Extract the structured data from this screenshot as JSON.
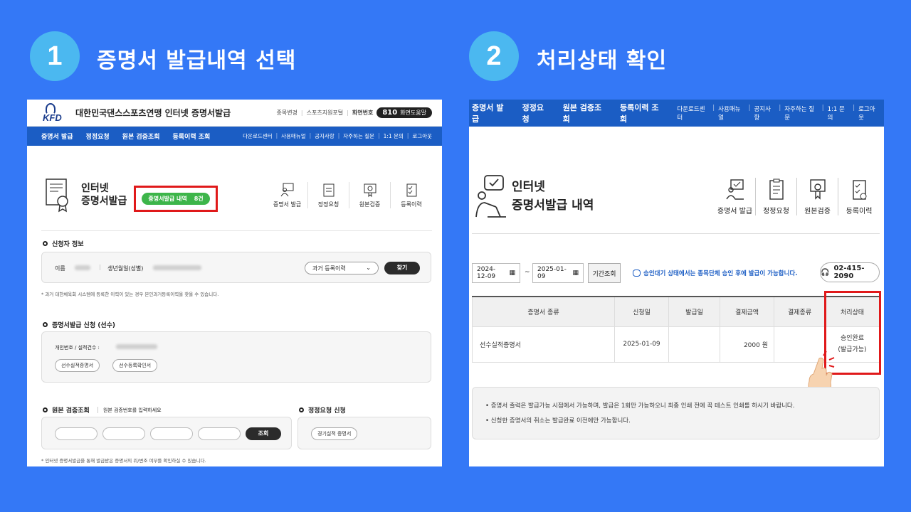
{
  "steps": [
    {
      "number": "1",
      "title": "증명서 발급내역 선택"
    },
    {
      "number": "2",
      "title": "처리상태 확인"
    }
  ],
  "left": {
    "logo_text": "KFD",
    "org_title": "대한민국댄스스포츠연맹 인터넷 증명서발급",
    "top_links": [
      "종목변경",
      "스포츠지원포털",
      "화면번호"
    ],
    "phone_code": "810",
    "phone_label": "화면도움말",
    "nav": [
      "증명서 발급",
      "정정요청",
      "원본 검증조회",
      "등록이력 조회"
    ],
    "nav_right": [
      "다운로드센터",
      "사용매뉴얼",
      "공지사항",
      "자주하는 질문",
      "1:1 문의",
      "로그아웃"
    ],
    "page_title_1": "인터넷",
    "page_title_2": "증명서발급",
    "badge_label": "증명서발급 내역",
    "badge_count": "8건",
    "quick": [
      "증명서 발급",
      "정정요청",
      "원본검증",
      "등록이력"
    ],
    "applicant": {
      "title": "신청자 정보",
      "name_label": "이름",
      "birth_label": "생년월일(성별)",
      "select_value": "과거 등록이력",
      "search_button": "찾기",
      "note": "* 과거 대한체육회 시스템에 등록한 이력이 있는 경우 본인과거등록이력을 찾을 수 있습니다."
    },
    "apply": {
      "title": "증명서발급 신청 (선수)",
      "id_label": "개인번호 / 실적건수 :",
      "buttons": [
        "선수실적증명서",
        "선수등록확인서"
      ]
    },
    "verify": {
      "title": "원본 검증조회",
      "hint": "원본 검증번호를 입력하세요",
      "button": "조회",
      "note": "* 인터넷 증명서발급을 통해 발급받은 증명서의 위/변조 여부를 확인하실 수 있습니다."
    },
    "correction": {
      "title": "정정요청 신청",
      "button": "경기실적 증명서"
    }
  },
  "right": {
    "nav": [
      "증명서 발급",
      "정정요청",
      "원본 검증조회",
      "등록이력 조회"
    ],
    "nav_right": [
      "다운로드센터",
      "사용매뉴얼",
      "공지사항",
      "자주하는 질문",
      "1:1 문의",
      "로그아웃"
    ],
    "page_title_1": "인터넷",
    "page_title_2": "증명서발급 내역",
    "quick": [
      "증명서 발급",
      "정정요청",
      "원본검증",
      "등록이력"
    ],
    "date_from": "2024-12-09",
    "date_sep": "~",
    "date_to": "2025-01-09",
    "period_button": "기간조회",
    "info": "승인대기 상태에서는 종목단체 승인 후에 발급이 가능합니다.",
    "tel": "02-415-2090",
    "table": {
      "headers": [
        "증명서 종류",
        "신청일",
        "발급일",
        "결제금액",
        "결제종류",
        "처리상태"
      ],
      "rows": [
        {
          "type": "선수실적증명서",
          "applied": "2025-01-09",
          "issued": "",
          "amount": "2000 원",
          "pay_type": "",
          "status": "승인완료",
          "status_sub": "(발급가능)"
        }
      ]
    },
    "notices": [
      "증명서 출력은 발급가능 시점에서 가능하며, 발급은 1회만 가능하오니 최종 인쇄 전에 꼭 테스트 인쇄를 하시기 바랍니다.",
      "신청한 증명서의 취소는 발급완료 이전에만 가능합니다."
    ]
  },
  "colors": {
    "background": "#3478f6",
    "step_circle": "#4bb8f0",
    "nav": "#1b5dc4",
    "badge": "#3db54a",
    "highlight": "#e0191a"
  }
}
